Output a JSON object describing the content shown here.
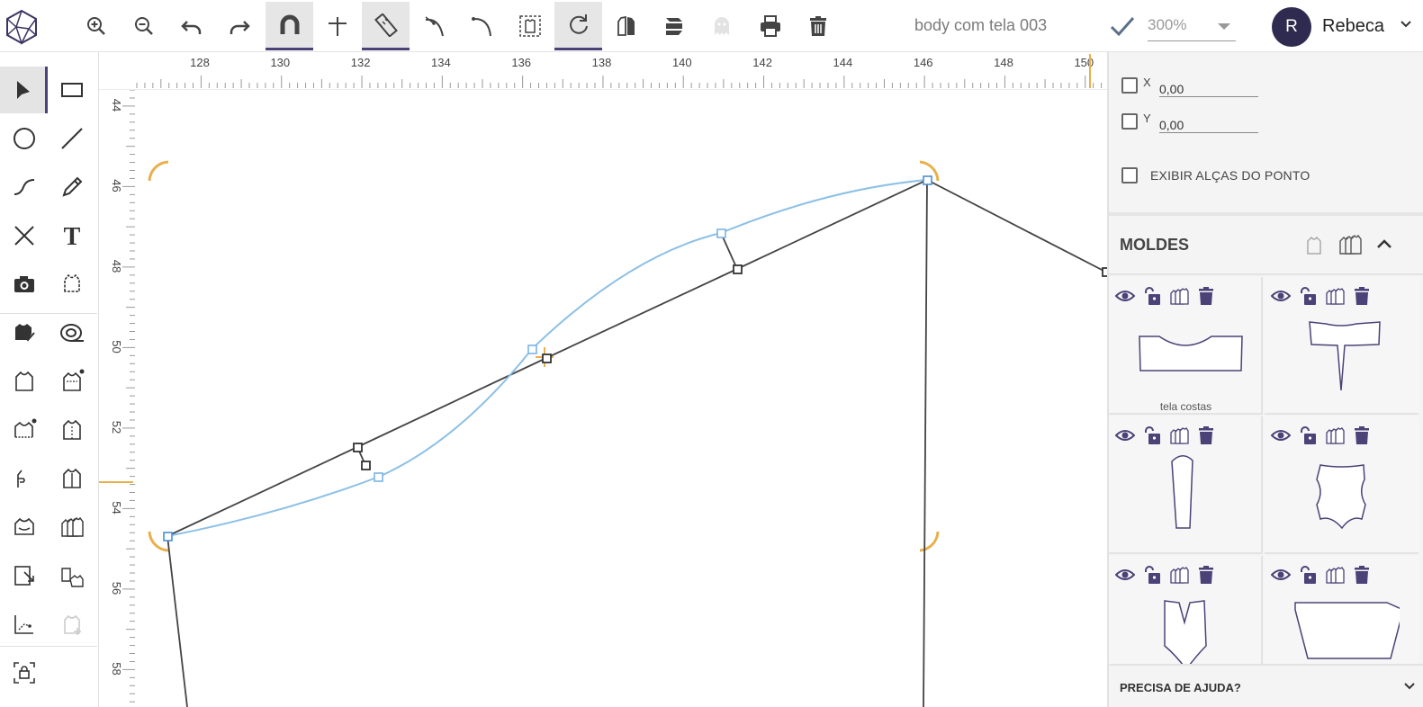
{
  "app": {
    "logo_icon": "hexagon-logo-icon",
    "accent": "#4b4277",
    "handle_color": "#e8b04a",
    "curve_color": "#8cc0e6"
  },
  "toolbar": {
    "buttons": [
      {
        "name": "zoom-in-button",
        "icon": "zoom-in-icon"
      },
      {
        "name": "zoom-out-button",
        "icon": "zoom-out-icon"
      },
      {
        "name": "undo-button",
        "icon": "undo-icon"
      },
      {
        "name": "redo-button",
        "icon": "redo-icon"
      },
      {
        "name": "magnet-button",
        "icon": "magnet-icon",
        "active": true
      },
      {
        "name": "crosshair-button",
        "icon": "crosshair-icon"
      },
      {
        "name": "ruler-button",
        "icon": "ruler-icon",
        "active": true
      },
      {
        "name": "curve-tool-button",
        "icon": "bezier-icon"
      },
      {
        "name": "curve-point-button",
        "icon": "curve-point-icon"
      },
      {
        "name": "select-pattern-button",
        "icon": "select-pattern-icon"
      },
      {
        "name": "rotate-button",
        "icon": "rotate-icon",
        "active": true
      },
      {
        "name": "mirror-pattern-button",
        "icon": "mirror-icon"
      },
      {
        "name": "pattern-layers-button",
        "icon": "layers-icon"
      },
      {
        "name": "ghost-button",
        "icon": "ghost-icon"
      },
      {
        "name": "print-button",
        "icon": "print-icon"
      },
      {
        "name": "delete-button",
        "icon": "trash-icon"
      }
    ],
    "document_title": "body com tela 003",
    "zoom_value": "300%"
  },
  "user": {
    "initial": "R",
    "name": "Rebeca"
  },
  "rulers": {
    "top_labels": [
      "128",
      "130",
      "132",
      "134",
      "136",
      "138",
      "140",
      "142",
      "144",
      "146",
      "148",
      "150"
    ],
    "left_labels": [
      "44",
      "46",
      "48",
      "50",
      "52",
      "54",
      "56",
      "58"
    ]
  },
  "right_panel": {
    "x_label": "X",
    "x_value": "0,00",
    "y_label": "Y",
    "y_value": "0,00",
    "show_handles_label": "EXIBIR ALÇAS DO PONTO",
    "moldes_title": "MOLDES",
    "pattern_names": [
      "tela costas",
      "",
      "",
      "",
      "",
      ""
    ],
    "help_label": "PRECISA DE AJUDA?"
  }
}
